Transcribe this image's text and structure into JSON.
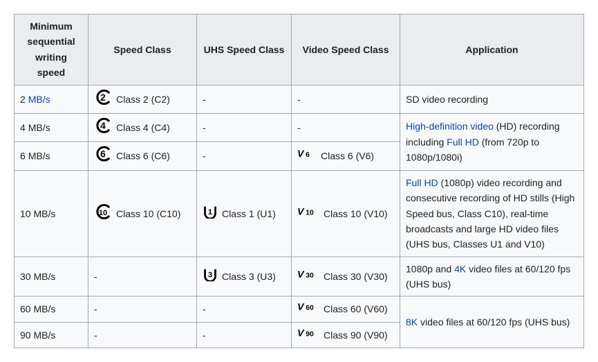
{
  "headers": {
    "min": "Minimum sequential writing speed",
    "speed_class": "Speed Class",
    "uhs": "UHS Speed Class",
    "video": "Video Speed Class",
    "app": "Application"
  },
  "units": {
    "mbs": "MB/s"
  },
  "links": {
    "mbs": "MB/s",
    "hd_video": "High-definition video",
    "full_hd": "Full HD",
    "k4": "4K",
    "k8": "8K"
  },
  "rows": {
    "r2": {
      "speed_prefix": "2 ",
      "speed_label": "Class 2 (C2)",
      "uhs": "-",
      "video": "-"
    },
    "r4": {
      "speed_prefix": "4 ",
      "speed_label": "Class 4 (C4)",
      "uhs": "-",
      "video": "-"
    },
    "r6": {
      "speed_prefix": "6 ",
      "speed_label": "Class 6 (C6)",
      "uhs": "-",
      "video_label": "Class 6 (V6)"
    },
    "r10": {
      "speed_prefix": "10 ",
      "speed_label": "Class 10 (C10)",
      "uhs_label": "Class 1 (U1)",
      "video_label": "Class 10 (V10)"
    },
    "r30": {
      "speed_prefix": "30 ",
      "speed": "-",
      "uhs_label": "Class 3 (U3)",
      "video_label": "Class 30 (V30)"
    },
    "r60": {
      "speed_prefix": "60 ",
      "speed": "-",
      "uhs": "-",
      "video_label": "Class 60 (V60)"
    },
    "r90": {
      "speed_prefix": "90 ",
      "speed": "-",
      "uhs": "-",
      "video_label": "Class 90 (V90)"
    }
  },
  "apps": {
    "sd": "SD video recording",
    "hd_pre": "",
    "hd_mid": " (HD) recording including ",
    "hd_post": " (from 720p to 1080p/1080i)",
    "fullhd_pre": "",
    "fullhd_post": " (1080p) video recording and consecutive recording of HD stills (High Speed bus, Class C10), real-time broadcasts and large HD video files (UHS bus, Classes U1 and V10)",
    "k4_pre": "1080p and ",
    "k4_post": " video files at 60/120 fps (UHS bus)",
    "k8_pre": "",
    "k8_post": " video files at 60/120 fps (UHS bus)"
  },
  "chart_data": {
    "type": "table",
    "title": "SD card speed class ratings",
    "columns": [
      "Minimum sequential writing speed",
      "Speed Class",
      "UHS Speed Class",
      "Video Speed Class",
      "Application"
    ],
    "rows": [
      [
        "2 MB/s",
        "Class 2 (C2)",
        "-",
        "-",
        "SD video recording"
      ],
      [
        "4 MB/s",
        "Class 4 (C4)",
        "-",
        "-",
        "High-definition video (HD) recording including Full HD (from 720p to 1080p/1080i)"
      ],
      [
        "6 MB/s",
        "Class 6 (C6)",
        "-",
        "Class 6 (V6)",
        "High-definition video (HD) recording including Full HD (from 720p to 1080p/1080i)"
      ],
      [
        "10 MB/s",
        "Class 10 (C10)",
        "Class 1 (U1)",
        "Class 10 (V10)",
        "Full HD (1080p) video recording and consecutive recording of HD stills (High Speed bus, Class C10), real-time broadcasts and large HD video files (UHS bus, Classes U1 and V10)"
      ],
      [
        "30 MB/s",
        "-",
        "Class 3 (U3)",
        "Class 30 (V30)",
        "1080p and 4K video files at 60/120 fps (UHS bus)"
      ],
      [
        "60 MB/s",
        "-",
        "-",
        "Class 60 (V60)",
        "8K video files at 60/120 fps (UHS bus)"
      ],
      [
        "90 MB/s",
        "-",
        "-",
        "Class 90 (V90)",
        "8K video files at 60/120 fps (UHS bus)"
      ]
    ]
  }
}
